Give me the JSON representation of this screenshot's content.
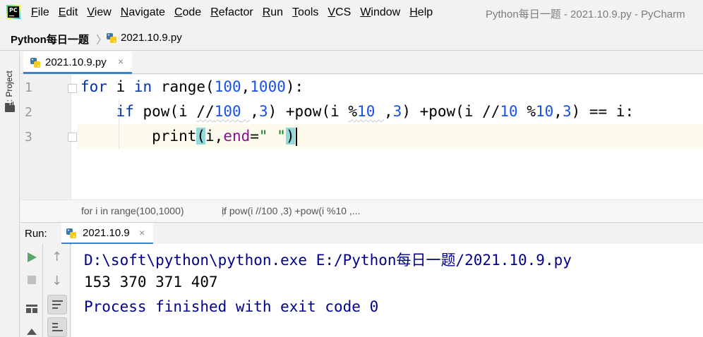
{
  "menubar": {
    "logo_text": "PC",
    "items": [
      {
        "mnemonic": "F",
        "rest": "ile"
      },
      {
        "mnemonic": "E",
        "rest": "dit"
      },
      {
        "mnemonic": "V",
        "rest": "iew"
      },
      {
        "mnemonic": "N",
        "rest": "avigate"
      },
      {
        "mnemonic": "C",
        "rest": "ode"
      },
      {
        "mnemonic": "R",
        "rest": "efactor"
      },
      {
        "mnemonic": "R",
        "rest": "un"
      },
      {
        "mnemonic": "T",
        "rest": "ools"
      },
      {
        "mnemonic": "V",
        "rest": "CS"
      },
      {
        "mnemonic": "W",
        "rest": "indow"
      },
      {
        "mnemonic": "H",
        "rest": "elp"
      }
    ],
    "window_title": "Python每日一题 - 2021.10.9.py - PyCharm"
  },
  "navbar": {
    "project": "Python每日一题",
    "separator": "〉",
    "file": "2021.10.9.py"
  },
  "left_strip": {
    "project_tab_num": "1",
    "project_tab_rest": ": Project"
  },
  "editor_tab": {
    "label": "2021.10.9.py",
    "close": "×"
  },
  "editor": {
    "line_numbers": [
      "1",
      "2",
      "3"
    ],
    "lines": [
      [
        {
          "t": "for",
          "c": "kw"
        },
        {
          "t": " i ",
          "c": ""
        },
        {
          "t": "in",
          "c": "kw"
        },
        {
          "t": " range(",
          "c": ""
        },
        {
          "t": "100",
          "c": "num"
        },
        {
          "t": ",",
          "c": ""
        },
        {
          "t": "1000",
          "c": "num"
        },
        {
          "t": "):",
          "c": ""
        }
      ],
      [
        {
          "t": "    ",
          "c": ""
        },
        {
          "t": "if",
          "c": "kw"
        },
        {
          "t": " pow(i ",
          "c": ""
        },
        {
          "t": "//",
          "c": "warn"
        },
        {
          "t": "100",
          "c": "num warn"
        },
        {
          "t": " ",
          "c": "warn"
        },
        {
          "t": ",",
          "c": ""
        },
        {
          "t": "3",
          "c": "num"
        },
        {
          "t": ") +pow(i ",
          "c": ""
        },
        {
          "t": "%",
          "c": "warn"
        },
        {
          "t": "10",
          "c": "num warn"
        },
        {
          "t": " ",
          "c": "warn"
        },
        {
          "t": ",",
          "c": ""
        },
        {
          "t": "3",
          "c": "num"
        },
        {
          "t": ") +pow(i //",
          "c": ""
        },
        {
          "t": "10",
          "c": "num"
        },
        {
          "t": " %",
          "c": ""
        },
        {
          "t": "10",
          "c": "num"
        },
        {
          "t": ",",
          "c": ""
        },
        {
          "t": "3",
          "c": "num"
        },
        {
          "t": ") == i:",
          "c": ""
        }
      ],
      [
        {
          "t": "        print",
          "c": ""
        },
        {
          "t": "(",
          "c": "brace-hl"
        },
        {
          "t": "i,",
          "c": ""
        },
        {
          "t": "end",
          "c": "param"
        },
        {
          "t": "=",
          "c": ""
        },
        {
          "t": "\" \"",
          "c": "str"
        },
        {
          "t": ")",
          "c": "brace-hl"
        }
      ]
    ]
  },
  "code_breadcrumbs": [
    "for i in range(100,1000)",
    "〉",
    "if pow(i //100 ,3) +pow(i %10 ,..."
  ],
  "run_panel": {
    "label": "Run:",
    "tab_label": "2021.10.9",
    "tab_close": "×"
  },
  "console": {
    "lines": [
      {
        "text": "D:\\soft\\python\\python.exe E:/Python每日一题/2021.10.9.py",
        "kind": "con-sys"
      },
      {
        "text": "153 370 371 407",
        "kind": "con-out"
      },
      {
        "text": "Process finished with exit code 0",
        "kind": "con-sys"
      }
    ]
  },
  "colors": {
    "keyword": "#0033b3",
    "number": "#1750eb",
    "string": "#067d17",
    "parameter": "#871094",
    "brace_highlight": "#93d9d9",
    "tab_underline": "#4083c9",
    "run_green": "#59a869"
  },
  "icons": {
    "python_file": "python-file-icon",
    "run": "play-icon",
    "stop": "stop-icon"
  }
}
